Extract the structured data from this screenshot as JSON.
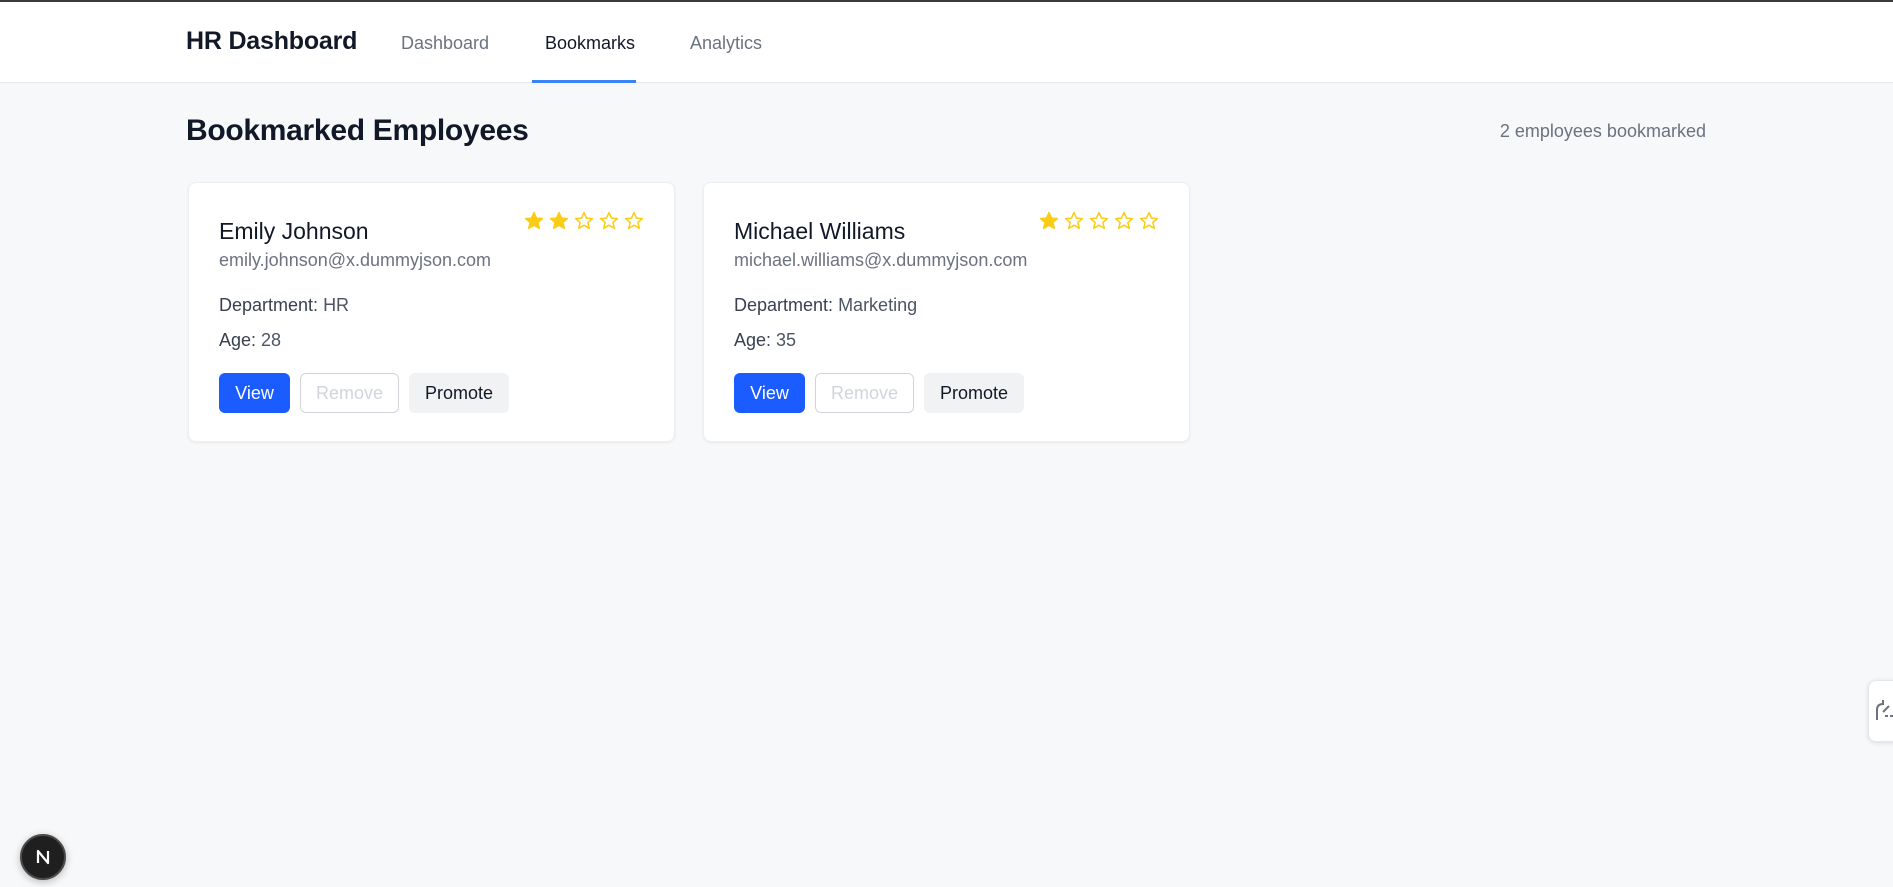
{
  "app": {
    "title": "HR Dashboard"
  },
  "nav": {
    "items": [
      {
        "label": "Dashboard",
        "active": false
      },
      {
        "label": "Bookmarks",
        "active": true
      },
      {
        "label": "Analytics",
        "active": false
      }
    ]
  },
  "page": {
    "title": "Bookmarked Employees",
    "count_text": "2 employees bookmarked"
  },
  "colors": {
    "accent": "#1a5cff",
    "nav_active_underline": "#3b82f6",
    "star_filled": "#facc15"
  },
  "labels": {
    "department": "Department:",
    "age": "Age:"
  },
  "employees": [
    {
      "name": "Emily Johnson",
      "email": "emily.johnson@x.dummyjson.com",
      "department": "HR",
      "age": "28",
      "rating": 2,
      "rating_max": 5,
      "buttons": {
        "view": "View",
        "remove": "Remove",
        "promote": "Promote"
      }
    },
    {
      "name": "Michael Williams",
      "email": "michael.williams@x.dummyjson.com",
      "department": "Marketing",
      "age": "35",
      "rating": 1,
      "rating_max": 5,
      "buttons": {
        "view": "View",
        "remove": "Remove",
        "promote": "Promote"
      }
    }
  ],
  "icons": {
    "star": "star-icon",
    "side_widget": "devtools-icon",
    "framework_badge": "nextjs-logo-icon"
  }
}
